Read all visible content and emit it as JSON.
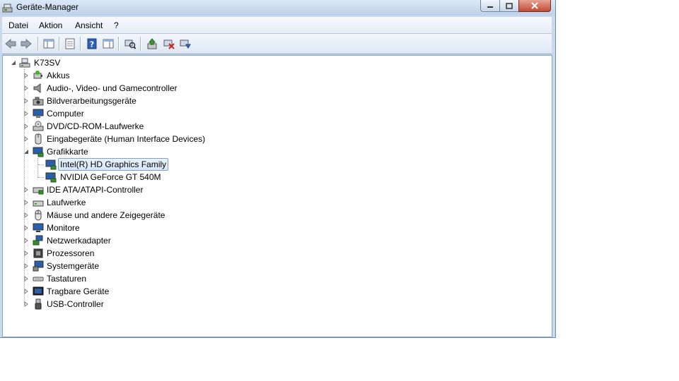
{
  "window": {
    "title": "Geräte-Manager",
    "icon": "device-manager-icon"
  },
  "menu": {
    "items": [
      "Datei",
      "Aktion",
      "Ansicht",
      "?"
    ]
  },
  "toolbar": {
    "buttons": [
      "back-arrow-icon",
      "forward-arrow-icon",
      "console-tree-icon",
      "properties-icon",
      "help-icon",
      "action-pane-icon",
      "scan-hardware-icon",
      "update-driver-icon",
      "disable-device-icon",
      "uninstall-device-icon"
    ]
  },
  "tree": {
    "root": "K73SV",
    "categories": [
      {
        "label": "Akkus",
        "icon": "battery-icon"
      },
      {
        "label": "Audio-, Video- und Gamecontroller",
        "icon": "speaker-icon"
      },
      {
        "label": "Bildverarbeitungsgeräte",
        "icon": "camera-icon"
      },
      {
        "label": "Computer",
        "icon": "computer-icon"
      },
      {
        "label": "DVD/CD-ROM-Laufwerke",
        "icon": "dvd-drive-icon"
      },
      {
        "label": "Eingabegeräte (Human Interface Devices)",
        "icon": "hid-icon"
      },
      {
        "label": "Grafikkarte",
        "icon": "display-adapter-icon",
        "expanded": true,
        "children": [
          {
            "label": "Intel(R) HD Graphics Family",
            "selected": true
          },
          {
            "label": "NVIDIA GeForce GT 540M"
          }
        ]
      },
      {
        "label": "IDE ATA/ATAPI-Controller",
        "icon": "ide-controller-icon"
      },
      {
        "label": "Laufwerke",
        "icon": "disk-drive-icon"
      },
      {
        "label": "Mäuse und andere Zeigegeräte",
        "icon": "mouse-icon"
      },
      {
        "label": "Monitore",
        "icon": "monitor-icon"
      },
      {
        "label": "Netzwerkadapter",
        "icon": "network-adapter-icon"
      },
      {
        "label": "Prozessoren",
        "icon": "processor-icon"
      },
      {
        "label": "Systemgeräte",
        "icon": "system-devices-icon"
      },
      {
        "label": "Tastaturen",
        "icon": "keyboard-icon"
      },
      {
        "label": "Tragbare Geräte",
        "icon": "portable-devices-icon"
      },
      {
        "label": "USB-Controller",
        "icon": "usb-icon"
      }
    ]
  },
  "colors": {
    "window_frame": "#c9daee",
    "selection_border": "#7da2ce",
    "close_button": "#c44b34"
  }
}
